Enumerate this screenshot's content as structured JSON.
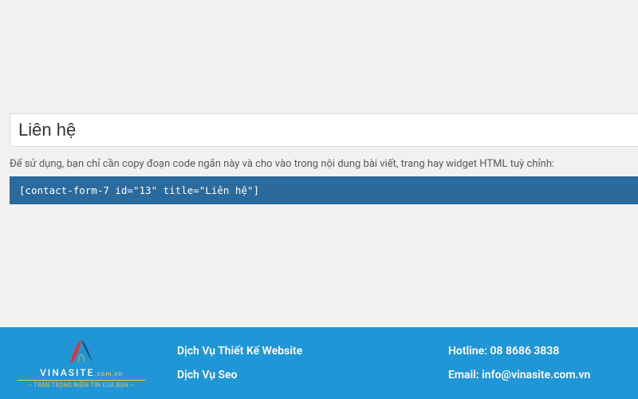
{
  "form": {
    "title_value": "Liên hệ",
    "instruction": "Để sử dụng, bạn chỉ cần copy đoạn code ngắn này và cho vào trong nội dung bài viết, trang hay widget HTML tuỳ chỉnh:",
    "shortcode": "[contact-form-7 id=\"13\" title=\"Liên hệ\"]"
  },
  "footer": {
    "logo_main": "VINASITE",
    "logo_domain": ".com.vn",
    "logo_tagline": "— TRÂN TRỌNG NIỀM TIN CỦA BẠN —",
    "services": [
      "Dịch Vụ Thiết Kế Website",
      "Dịch Vụ Seo"
    ],
    "contact": {
      "hotline_label": "Hotline:",
      "hotline_value": "08 8686 3838",
      "email_label": "Email:",
      "email_value": "info@vinasite.com.vn"
    }
  },
  "colors": {
    "footer_bg": "#2196d6",
    "shortcode_bg": "#2b6a9c",
    "accent_gold": "#e4c35a",
    "page_bg": "#f1f1f1"
  }
}
